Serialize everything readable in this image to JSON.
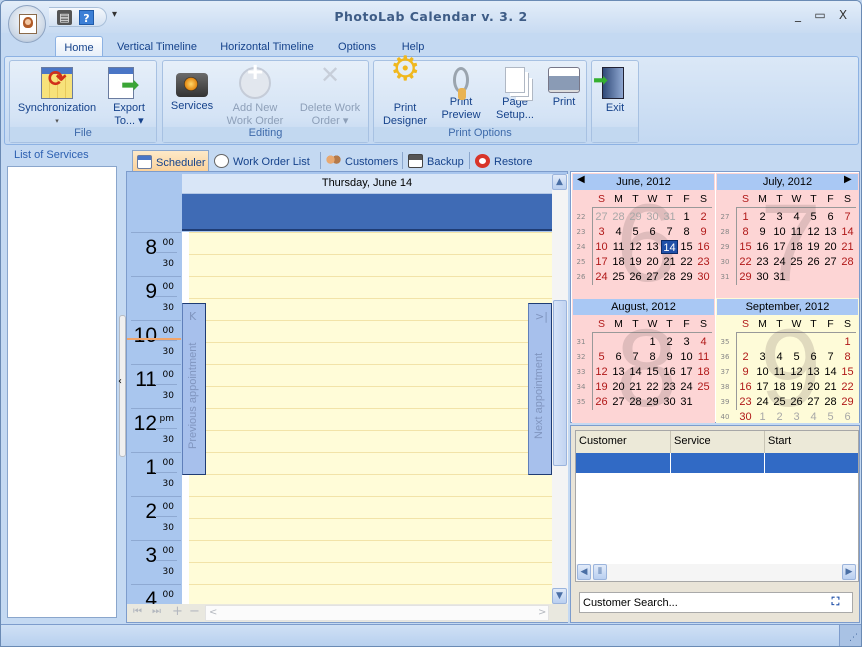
{
  "window": {
    "title": "PhotoLab Calendar v. 3. 2",
    "controls": {
      "minimize": "_",
      "maximize": "▭",
      "close": "X"
    }
  },
  "quick_access": {
    "print_icon": "printer-icon",
    "help_icon": "?",
    "more": "▾"
  },
  "menu_tabs": [
    {
      "label": "Home",
      "active": true
    },
    {
      "label": "Vertical Timeline"
    },
    {
      "label": "Horizontal Timeline"
    },
    {
      "label": "Options"
    },
    {
      "label": "Help"
    }
  ],
  "ribbon": {
    "groups": [
      {
        "label": "File",
        "buttons": [
          {
            "line1": "Synchronization",
            "line2": "▾",
            "icon": "synchronization-icon",
            "enabled": true
          },
          {
            "line1": "Export",
            "line2": "To... ▾",
            "icon": "export-icon",
            "enabled": true
          }
        ]
      },
      {
        "label": "Editing",
        "buttons": [
          {
            "line1": "Services",
            "line2": "",
            "icon": "camera-icon",
            "enabled": true
          },
          {
            "line1": "Add New",
            "line2": "Work Order",
            "icon": "add-icon",
            "enabled": false
          },
          {
            "line1": "Delete Work",
            "line2": "Order ▾",
            "icon": "delete-icon",
            "enabled": false
          }
        ]
      },
      {
        "label": "Print Options",
        "buttons": [
          {
            "line1": "Print",
            "line2": "Designer",
            "icon": "gear-icon",
            "enabled": true
          },
          {
            "line1": "Print",
            "line2": "Preview",
            "icon": "magnifier-icon",
            "enabled": true
          },
          {
            "line1": "Page",
            "line2": "Setup...",
            "icon": "pages-icon",
            "enabled": true
          },
          {
            "line1": "Print",
            "line2": "",
            "icon": "printer-icon",
            "enabled": true
          }
        ]
      },
      {
        "label": "",
        "buttons": [
          {
            "line1": "Exit",
            "line2": "",
            "icon": "exit-door-icon",
            "enabled": true
          }
        ]
      }
    ]
  },
  "left_panel": {
    "title": "List of Services"
  },
  "view_tabs": [
    {
      "label": "Scheduler",
      "active": true
    },
    {
      "label": "Work Order List"
    },
    {
      "label": "Customers"
    },
    {
      "label": "Backup"
    },
    {
      "label": "Restore"
    }
  ],
  "scheduler": {
    "day_header": "Thursday, June 14",
    "times": [
      {
        "hour": "8",
        "suffix": "00"
      },
      {
        "hour": "9",
        "suffix": "00"
      },
      {
        "hour": "10",
        "suffix": "00"
      },
      {
        "hour": "11",
        "suffix": "00"
      },
      {
        "hour": "12",
        "suffix": "pm"
      },
      {
        "hour": "1",
        "suffix": "00"
      },
      {
        "hour": "2",
        "suffix": "00"
      },
      {
        "hour": "3",
        "suffix": "00"
      },
      {
        "hour": "4",
        "suffix": "00"
      }
    ],
    "half_label": "30",
    "prev_appointment": "Previous appointment",
    "next_appointment": "Next appointment",
    "prev_chevron": "K",
    "next_chevron": ">|",
    "nav": {
      "first": "⏮",
      "last": "⏭",
      "add": "+",
      "remove": "−",
      "left": "<",
      "right": ">"
    }
  },
  "calendars": {
    "weekdays": [
      "S",
      "M",
      "T",
      "W",
      "T",
      "F",
      "S"
    ],
    "months": [
      {
        "title": "June, 2012",
        "big": "6",
        "bg": "#fdd5d5",
        "weeks": [
          22,
          23,
          24,
          25,
          26
        ],
        "rows": [
          [
            27,
            28,
            29,
            30,
            31,
            1,
            2
          ],
          [
            3,
            4,
            5,
            6,
            7,
            8,
            9
          ],
          [
            10,
            11,
            12,
            13,
            14,
            15,
            16
          ],
          [
            17,
            18,
            19,
            20,
            21,
            22,
            23
          ],
          [
            24,
            25,
            26,
            27,
            28,
            29,
            30
          ]
        ],
        "lead_gray": 5,
        "trail_gray": 0,
        "selected": 14
      },
      {
        "title": "July, 2012",
        "big": "7",
        "bg": "#fdd5d5",
        "weeks": [
          27,
          28,
          29,
          30,
          31
        ],
        "rows": [
          [
            1,
            2,
            3,
            4,
            5,
            6,
            7
          ],
          [
            8,
            9,
            10,
            11,
            12,
            13,
            14
          ],
          [
            15,
            16,
            17,
            18,
            19,
            20,
            21
          ],
          [
            22,
            23,
            24,
            25,
            26,
            27,
            28
          ],
          [
            29,
            30,
            31,
            null,
            null,
            null,
            null
          ]
        ],
        "lead_gray": 0,
        "trail_gray": 0
      },
      {
        "title": "August, 2012",
        "big": "8",
        "bg": "#fdd5d5",
        "weeks": [
          31,
          32,
          33,
          34,
          35
        ],
        "rows": [
          [
            null,
            null,
            null,
            1,
            2,
            3,
            4
          ],
          [
            5,
            6,
            7,
            8,
            9,
            10,
            11
          ],
          [
            12,
            13,
            14,
            15,
            16,
            17,
            18
          ],
          [
            19,
            20,
            21,
            22,
            23,
            24,
            25
          ],
          [
            26,
            27,
            28,
            29,
            30,
            31,
            null
          ]
        ],
        "lead_gray": 0,
        "trail_gray": 0
      },
      {
        "title": "September, 2012",
        "big": "9",
        "bg": "#fefbd8",
        "weeks": [
          35,
          36,
          37,
          38,
          39,
          40
        ],
        "rows": [
          [
            null,
            null,
            null,
            null,
            null,
            null,
            1
          ],
          [
            2,
            3,
            4,
            5,
            6,
            7,
            8
          ],
          [
            9,
            10,
            11,
            12,
            13,
            14,
            15
          ],
          [
            16,
            17,
            18,
            19,
            20,
            21,
            22
          ],
          [
            23,
            24,
            25,
            26,
            27,
            28,
            29
          ],
          [
            30,
            1,
            2,
            3,
            4,
            5,
            6
          ]
        ],
        "lead_gray": 0,
        "trail_gray": 6
      }
    ]
  },
  "work_list": {
    "columns": [
      "Customer",
      "Service",
      "Start"
    ],
    "search_placeholder": "Customer Search..."
  },
  "colors": {
    "accent": "#3f6bb5",
    "selection": "#316ac5",
    "weekend": "#b01818"
  }
}
